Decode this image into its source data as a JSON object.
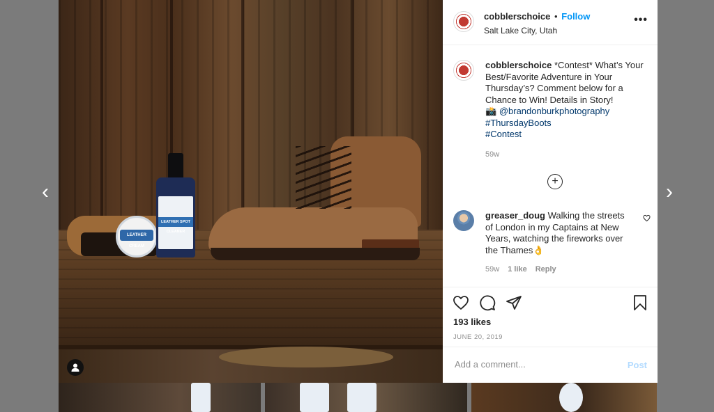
{
  "post": {
    "username": "cobblerschoice",
    "follow_label": "Follow",
    "separator": "•",
    "location": "Salt Lake City, Utah",
    "more_label": "•••"
  },
  "caption": {
    "username": "cobblerschoice",
    "text": "*Contest* What’s Your Best/Favorite Adventure in Your Thursday’s? Comment below for a Chance to Win! Details in Story!",
    "camera_emoji": "📸",
    "mention": "@brandonburkphotography",
    "hashtag1": "#ThursdayBoots",
    "hashtag2": "#Contest",
    "age": "59w"
  },
  "load_more_label": "+",
  "comment": {
    "username": "greaser_doug",
    "text": "Walking the streets of London in my Captains at New Years, watching the fireworks over the Thames👌",
    "age": "59w",
    "likes": "1 like",
    "reply": "Reply"
  },
  "likes": "193 likes",
  "date": "JUNE 20, 2019",
  "add_comment": {
    "placeholder": "Add a comment...",
    "post_label": "Post"
  },
  "photo": {
    "tin_label": "LEATHER CREAM",
    "bottle_label": "LEATHER SPOT CLEANER"
  },
  "nav": {
    "prev": "‹",
    "next": "›"
  },
  "colors": {
    "follow": "#0095f6",
    "link": "#00376b",
    "muted": "#8e8e8e",
    "post_disabled": "#b3dbff",
    "backdrop": "#7b7b7b"
  }
}
